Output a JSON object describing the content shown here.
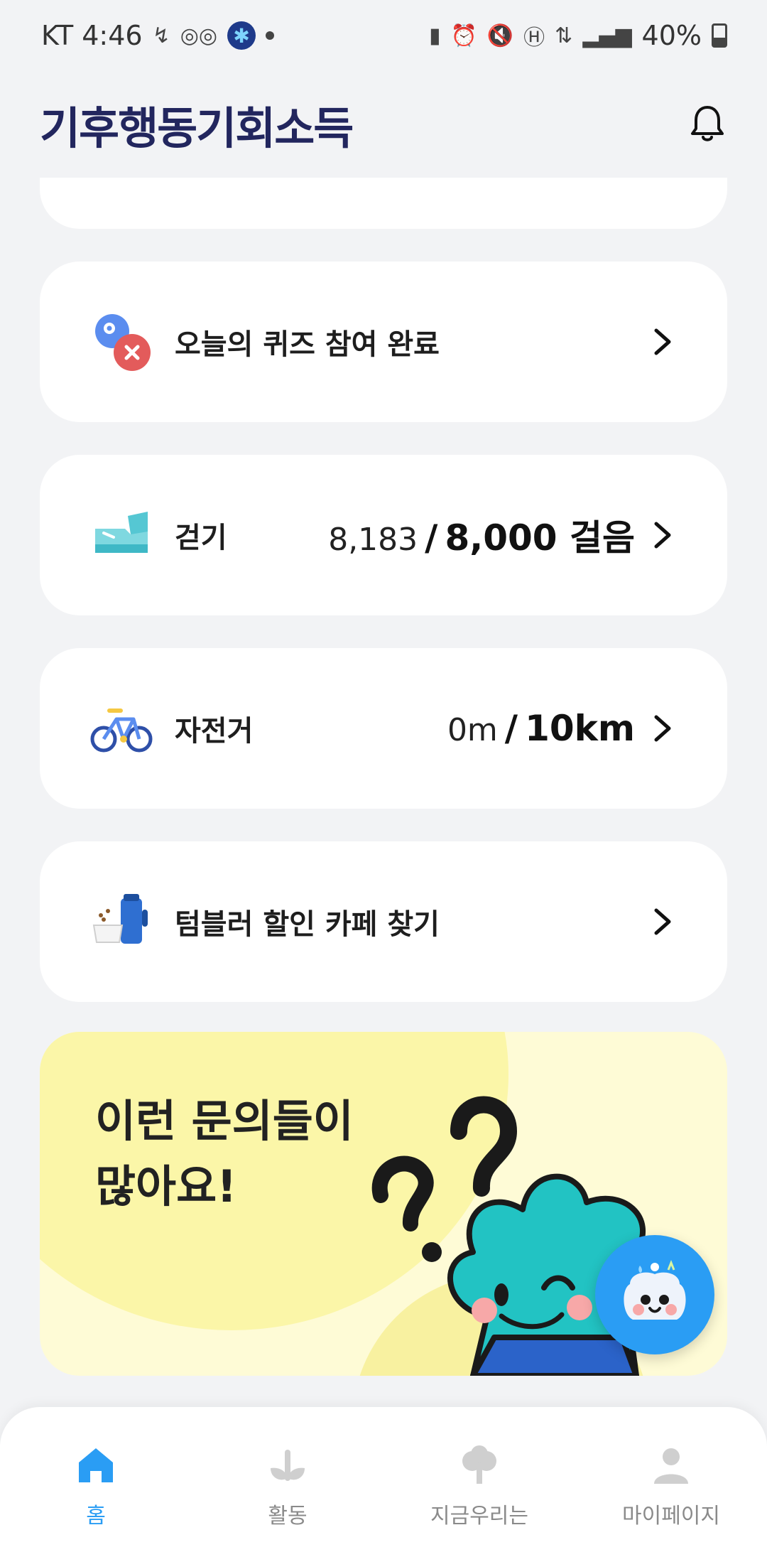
{
  "status_bar": {
    "carrier_time": "KT 4:46",
    "battery": "40%"
  },
  "header": {
    "logo_text": "기후행동기회소득"
  },
  "rows": [
    {
      "id": "quiz",
      "label": "오늘의 퀴즈 참여 완료",
      "icon": "quiz-icon"
    },
    {
      "id": "walk",
      "label": "걷기",
      "current": "8,183",
      "separator": "/",
      "target": "8,000 걸음",
      "icon": "shoe-icon"
    },
    {
      "id": "bike",
      "label": "자전거",
      "current": "0m",
      "separator": "/",
      "target": "10km",
      "icon": "bicycle-icon"
    },
    {
      "id": "tumbler",
      "label": "텀블러 할인 카페 찾기",
      "icon": "tumbler-icon"
    }
  ],
  "banner": {
    "title": "이런 문의들이\n많아요!"
  },
  "bottom_nav": [
    {
      "id": "home",
      "label": "홈",
      "active": true
    },
    {
      "id": "activity",
      "label": "활동",
      "active": false
    },
    {
      "id": "now",
      "label": "지금우리는",
      "active": false
    },
    {
      "id": "mypage",
      "label": "마이페이지",
      "active": false
    }
  ],
  "colors": {
    "accent": "#2a9df4",
    "logo_navy": "#22265e",
    "banner_bg": "#fefbd6"
  }
}
